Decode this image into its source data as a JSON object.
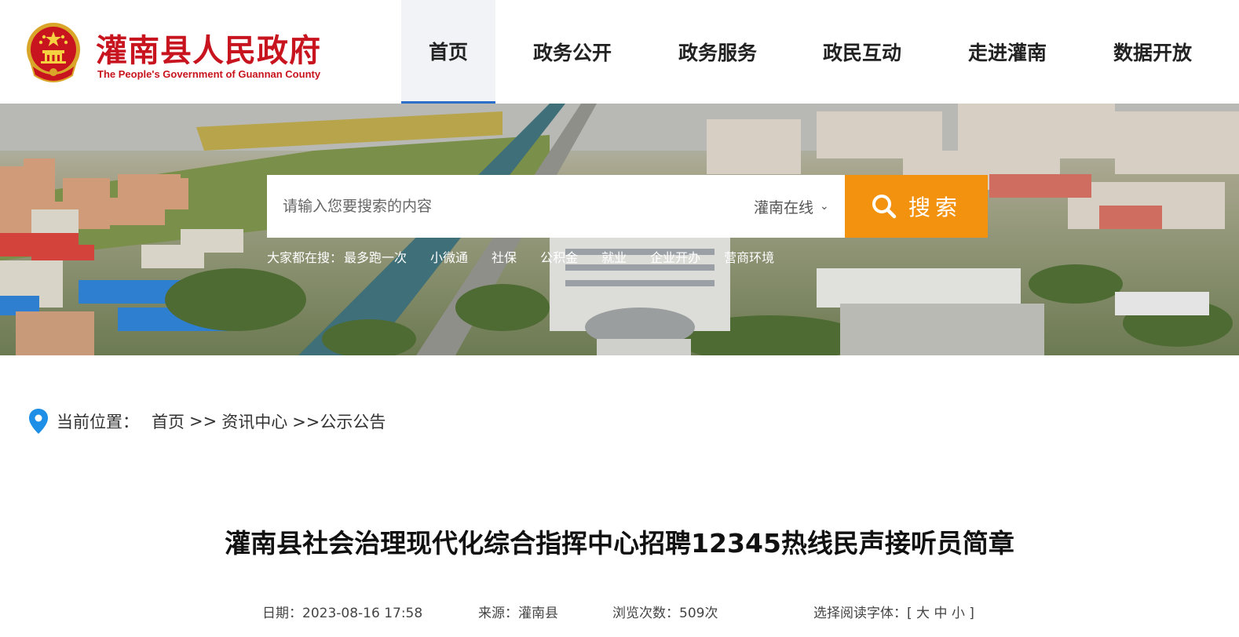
{
  "header": {
    "site_title": "灌南县人民政府",
    "site_subtitle": "The People's Government of Guannan County"
  },
  "nav": {
    "items": [
      {
        "label": "首页",
        "active": true
      },
      {
        "label": "政务公开",
        "active": false
      },
      {
        "label": "政务服务",
        "active": false
      },
      {
        "label": "政民互动",
        "active": false
      },
      {
        "label": "走进灌南",
        "active": false
      },
      {
        "label": "数据开放",
        "active": false
      }
    ]
  },
  "search": {
    "placeholder": "请输入您要搜索的内容",
    "scope": "灌南在线",
    "button_label": "搜索",
    "hot_label": "大家都在搜：",
    "hot_links": [
      "最多跑一次",
      "小微通",
      "社保",
      "公积金",
      "就业",
      "企业开办",
      "营商环境"
    ]
  },
  "breadcrumb": {
    "label": "当前位置：",
    "items": [
      "首页",
      ">>",
      "资讯中心",
      ">>公示公告"
    ]
  },
  "article": {
    "title": "灌南县社会治理现代化综合指挥中心招聘12345热线民声接听员简章",
    "date": "日期：2023-08-16 17:58",
    "source": "来源：灌南县",
    "views": "浏览次数：509次",
    "font_label": "选择阅读字体：[",
    "font_large": "大",
    "font_medium": "中",
    "font_small": "小",
    "font_close": "]"
  },
  "colors": {
    "brand_red": "#c8141e",
    "search_orange": "#f3920f",
    "nav_active_underline": "#2b6fc9",
    "pin_blue": "#1e8fe6"
  },
  "icons": {
    "emblem": "national-emblem-icon",
    "search": "search-icon",
    "scope_dropdown": "chevron-down-icon",
    "location": "location-pin-icon"
  }
}
